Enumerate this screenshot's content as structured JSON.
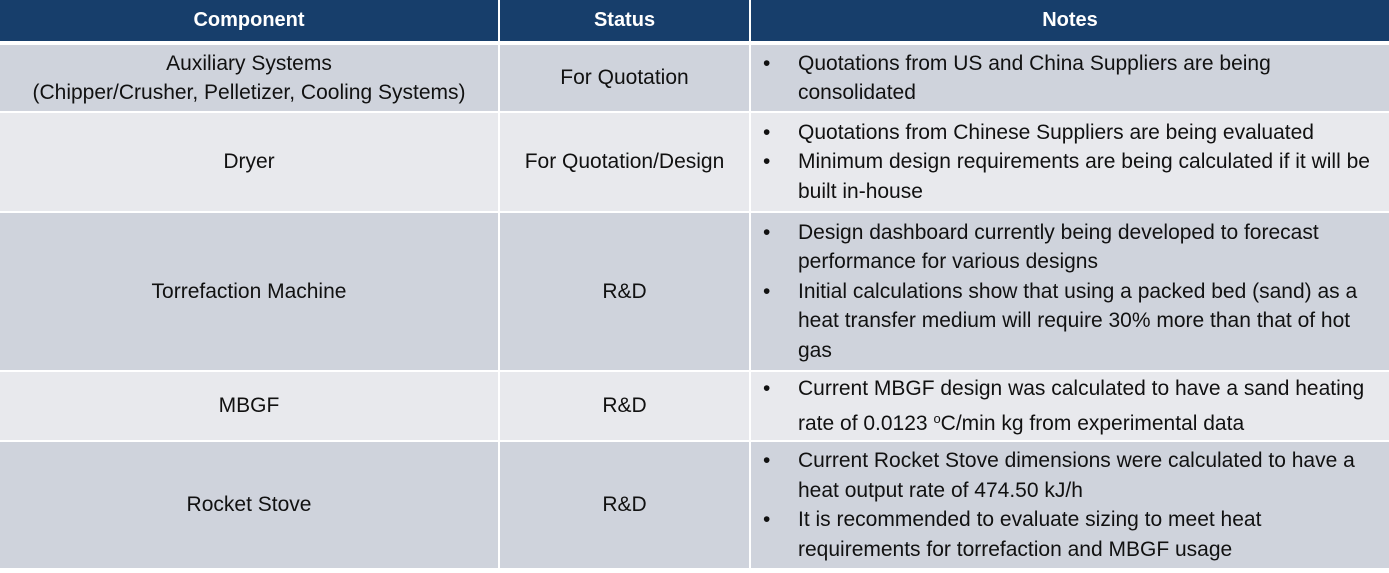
{
  "headers": {
    "component": "Component",
    "status": "Status",
    "notes": "Notes"
  },
  "rows": [
    {
      "component_line1": "Auxiliary Systems",
      "component_line2": "(Chipper/Crusher, Pelletizer, Cooling Systems)",
      "status": "For Quotation",
      "notes": [
        "Quotations from US and China Suppliers are being consolidated"
      ]
    },
    {
      "component_line1": "Dryer",
      "status": "For Quotation/Design",
      "notes": [
        "Quotations from Chinese Suppliers are being evaluated",
        "Minimum design requirements are being calculated if it will be built in-house"
      ]
    },
    {
      "component_line1": "Torrefaction Machine",
      "status": "R&D",
      "notes": [
        "Design dashboard currently being developed to forecast performance for various designs",
        "Initial calculations show that using a packed bed (sand) as a heat transfer medium will require 30% more than that of hot gas"
      ]
    },
    {
      "component_line1": "MBGF",
      "status": "R&D",
      "notes_rich": {
        "before": "Current MBGF design was calculated to have a sand heating rate of 0.0123 ",
        "sup": "o",
        "after": "C/min kg from experimental data"
      }
    },
    {
      "component_line1": "Rocket Stove",
      "status": "R&D",
      "notes": [
        "Current Rocket Stove dimensions were calculated to have a heat output rate of 474.50 kJ/h",
        "It is recommended to evaluate sizing to meet heat requirements for torrefaction and MBGF usage"
      ]
    }
  ],
  "bullet_glyph": "•",
  "colors": {
    "header_bg": "#173e6b",
    "row_dark": "#cfd3dc",
    "row_light": "#e8e9ed"
  }
}
